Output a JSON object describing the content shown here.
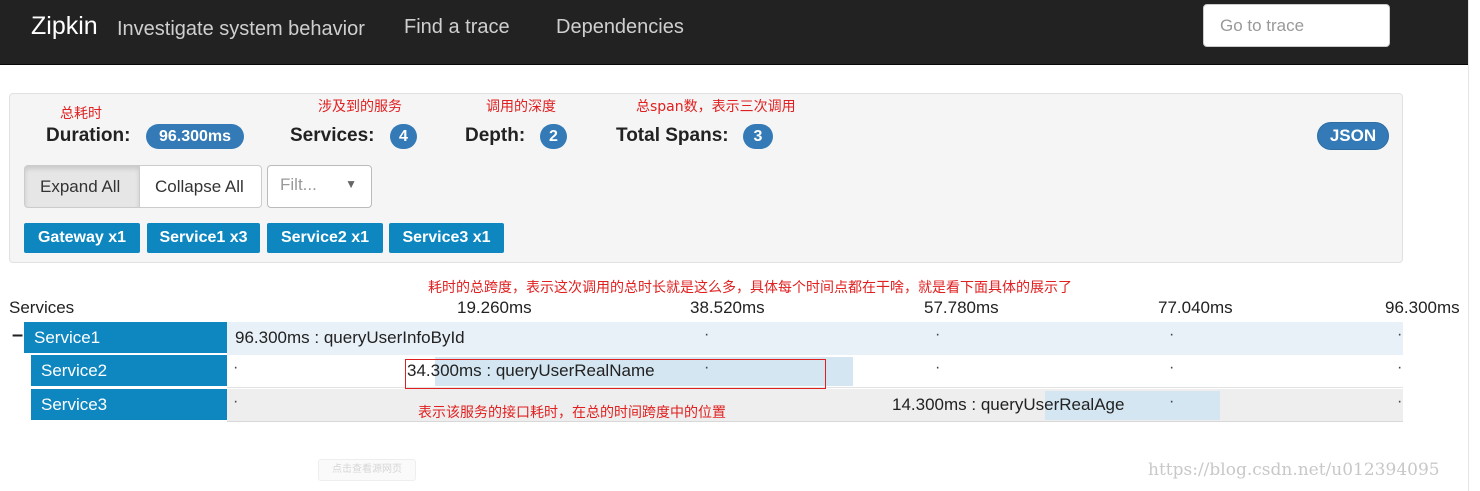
{
  "navbar": {
    "brand": "Zipkin",
    "tagline": "Investigate system behavior",
    "links": [
      "Find a trace",
      "Dependencies"
    ],
    "goto_placeholder": "Go to trace"
  },
  "annotations": {
    "duration": "总耗时",
    "services": "涉及到的服务",
    "depth": "调用的深度",
    "total_spans": "总span数，表示三次调用",
    "timeline": "耗时的总跨度，表示这次调用的总时长就是这么多，具体每个时间点都在干啥，就是看下面具体的展示了",
    "span_position": "表示该服务的接口耗时，在总的时间跨度中的位置"
  },
  "summary": {
    "duration_label": "Duration:",
    "duration_value": "96.300ms",
    "services_label": "Services:",
    "services_value": "4",
    "depth_label": "Depth:",
    "depth_value": "2",
    "total_spans_label": "Total Spans:",
    "total_spans_value": "3",
    "json_button": "JSON"
  },
  "controls": {
    "expand_all": "Expand All",
    "collapse_all": "Collapse All",
    "filter_placeholder": "Filt...",
    "filter_caret": "▼"
  },
  "service_tags": [
    "Gateway x1",
    "Service1 x3",
    "Service2 x1",
    "Service3 x1"
  ],
  "timeline": {
    "services_header": "Services",
    "ticks": [
      "19.260ms",
      "38.520ms",
      "57.780ms",
      "77.040ms",
      "96.300ms"
    ],
    "total_ms": 96.3,
    "toggle_symbol": "–",
    "rows": [
      {
        "service": "Service1",
        "label": "96.300ms : queryUserInfoById",
        "start_ms": 0,
        "duration_ms": 96.3
      },
      {
        "service": "Service2",
        "label": "34.300ms : queryUserRealName",
        "start_ms": 17.0,
        "duration_ms": 34.3
      },
      {
        "service": "Service3",
        "label": "14.300ms : queryUserRealAge",
        "start_ms": 67.0,
        "duration_ms": 14.3
      }
    ]
  },
  "watermark": "https://blog.csdn.net/u012394095",
  "faint_button": "点击查看源网页",
  "colors": {
    "navbar_bg": "#222222",
    "badge_blue": "#337ab7",
    "service_teal": "#0e87c0",
    "annotation_red": "#e02020",
    "span_fill": "#d4e6f1"
  }
}
